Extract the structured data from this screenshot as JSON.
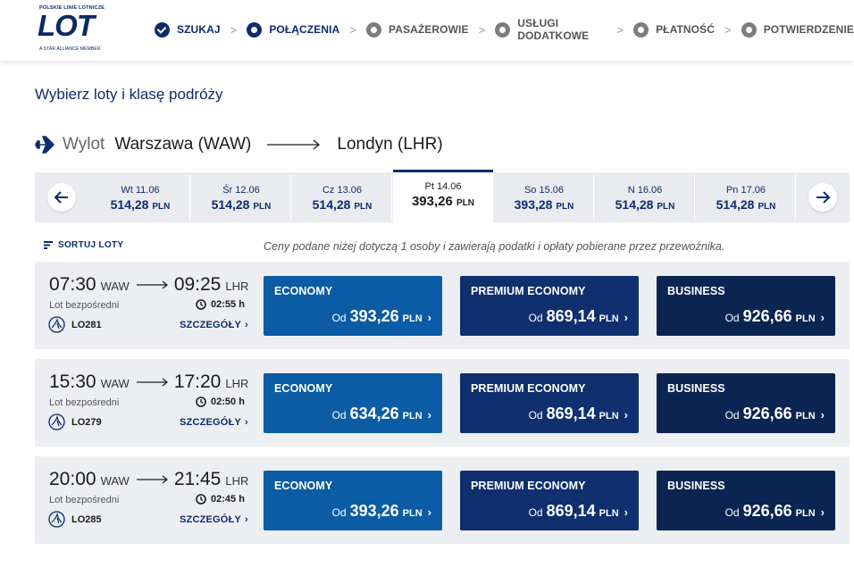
{
  "header": {
    "logo": {
      "brand": "LOT",
      "top_text": "POLSKIE LINIE LOTNICZE",
      "bottom_text": "A STAR ALLIANCE MEMBER"
    },
    "steps": [
      {
        "label": "SZUKAJ",
        "state": "done"
      },
      {
        "label": "POŁĄCZENIA",
        "state": "current"
      },
      {
        "label": "PASAŻEROWIE",
        "state": "todo"
      },
      {
        "label": "USŁUGI DODATKOWE",
        "state": "todo"
      },
      {
        "label": "PŁATNOŚĆ",
        "state": "todo"
      },
      {
        "label": "POTWIERDZENIE",
        "state": "todo"
      }
    ],
    "separator": ">"
  },
  "page_title": "Wybierz loty i klasę podróży",
  "route": {
    "label": "Wylot",
    "from": "Warszawa (WAW)",
    "to": "Londyn (LHR)"
  },
  "dates": [
    {
      "date": "Wt 11.06",
      "price": "514,28",
      "currency": "PLN"
    },
    {
      "date": "Śr 12.06",
      "price": "514,28",
      "currency": "PLN"
    },
    {
      "date": "Cz 13.06",
      "price": "514,28",
      "currency": "PLN"
    },
    {
      "date": "Pt 14.06",
      "price": "393,26",
      "currency": "PLN",
      "selected": true
    },
    {
      "date": "So 15.06",
      "price": "393,28",
      "currency": "PLN"
    },
    {
      "date": "N 16.06",
      "price": "514,28",
      "currency": "PLN"
    },
    {
      "date": "Pn 17.06",
      "price": "514,28",
      "currency": "PLN"
    }
  ],
  "sort_label": "SORTUJ LOTY",
  "info_text": "Ceny podane niżej dotyczą 1 osoby i zawierają podatki i opłaty pobierane przez przewoźnika.",
  "flights": [
    {
      "dep_time": "07:30",
      "dep_code": "WAW",
      "arr_time": "09:25",
      "arr_code": "LHR",
      "direct": "Lot bezpośredni",
      "duration": "02:55 h",
      "flight_no": "LO281",
      "details": "SZCZEGÓŁY",
      "fares": [
        {
          "class": "ECONOMY",
          "prefix": "Od",
          "amount": "393,26",
          "currency": "PLN"
        },
        {
          "class": "PREMIUM ECONOMY",
          "prefix": "Od",
          "amount": "869,14",
          "currency": "PLN"
        },
        {
          "class": "BUSINESS",
          "prefix": "Od",
          "amount": "926,66",
          "currency": "PLN"
        }
      ]
    },
    {
      "dep_time": "15:30",
      "dep_code": "WAW",
      "arr_time": "17:20",
      "arr_code": "LHR",
      "direct": "Lot bezpośredni",
      "duration": "02:50 h",
      "flight_no": "LO279",
      "details": "SZCZEGÓŁY",
      "fares": [
        {
          "class": "ECONOMY",
          "prefix": "Od",
          "amount": "634,26",
          "currency": "PLN"
        },
        {
          "class": "PREMIUM ECONOMY",
          "prefix": "Od",
          "amount": "869,14",
          "currency": "PLN"
        },
        {
          "class": "BUSINESS",
          "prefix": "Od",
          "amount": "926,66",
          "currency": "PLN"
        }
      ]
    },
    {
      "dep_time": "20:00",
      "dep_code": "WAW",
      "arr_time": "21:45",
      "arr_code": "LHR",
      "direct": "Lot bezpośredni",
      "duration": "02:45 h",
      "flight_no": "LO285",
      "details": "SZCZEGÓŁY",
      "fares": [
        {
          "class": "ECONOMY",
          "prefix": "Od",
          "amount": "393,26",
          "currency": "PLN"
        },
        {
          "class": "PREMIUM ECONOMY",
          "prefix": "Od",
          "amount": "869,14",
          "currency": "PLN"
        },
        {
          "class": "BUSINESS",
          "prefix": "Od",
          "amount": "926,66",
          "currency": "PLN"
        }
      ]
    }
  ],
  "colors": {
    "brand_navy": "#0d2c6c",
    "economy": "#0b5ca4",
    "premium_economy": "#0f2f6e",
    "business": "#0b2552",
    "row_bg": "#eceef1"
  },
  "icons": {
    "route": "plane-icon",
    "prev": "arrow-left-icon",
    "next": "arrow-right-icon",
    "sort": "sort-icon",
    "duration": "clock-icon",
    "airline": "crane-logo-icon",
    "chevron": "chevron-right-icon"
  }
}
